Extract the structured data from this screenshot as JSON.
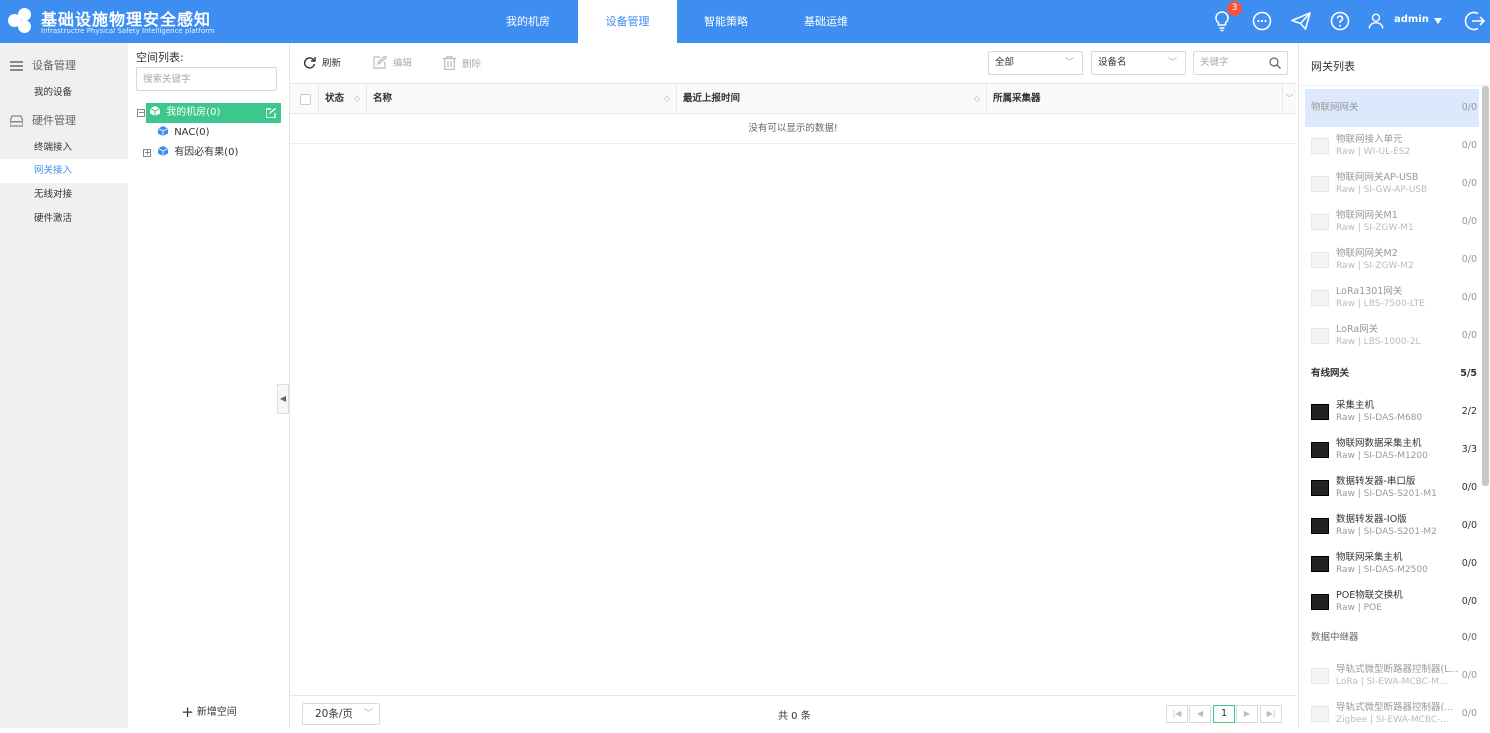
{
  "app": {
    "title": "基础设施物理安全感知",
    "subtitle": "Infrastructre Physical Safety Intelligence platform",
    "accent_color": "#3d8ef0",
    "success_color": "#3ec78c"
  },
  "nav": {
    "items": [
      {
        "label": "我的机房",
        "active": false
      },
      {
        "label": "设备管理",
        "active": true
      },
      {
        "label": "智能策略",
        "active": false
      },
      {
        "label": "基础运维",
        "active": false
      }
    ]
  },
  "topbar": {
    "notification_count": "3",
    "user": "admin",
    "icons": [
      "lightbulb-icon",
      "chat-icon",
      "send-icon",
      "help-icon",
      "user-icon",
      "logout-icon"
    ]
  },
  "sidebar": {
    "groups": [
      {
        "label": "设备管理",
        "icon": "list-icon",
        "items": [
          {
            "label": "我的设备",
            "active": false
          }
        ]
      },
      {
        "label": "硬件管理",
        "icon": "hardware-icon",
        "items": [
          {
            "label": "终端接入",
            "active": false
          },
          {
            "label": "网关接入",
            "active": true
          },
          {
            "label": "无线对接",
            "active": false
          },
          {
            "label": "硬件激活",
            "active": false
          }
        ]
      }
    ]
  },
  "tree": {
    "title": "空间列表:",
    "search_placeholder": "搜索关键字",
    "nodes": [
      {
        "label": "我的机房(0)",
        "toggle": "⊟"
      },
      {
        "label": "NAC(0)"
      },
      {
        "label": "有因必有果(0)",
        "toggle": "⊞"
      }
    ],
    "add_label": "新增空间"
  },
  "toolbar": {
    "refresh": "刷新",
    "edit": "编辑",
    "delete": "删除",
    "filter_scope": "全部",
    "filter_field": "设备名",
    "keyword_placeholder": "关键字"
  },
  "grid": {
    "columns": [
      "状态",
      "名称",
      "最近上报时间",
      "所属采集器"
    ],
    "empty_text": "没有可以显示的数据!"
  },
  "footer": {
    "page_size": "20条/页",
    "total": "共 0 条",
    "current_page": "1"
  },
  "gateways": {
    "title": "网关列表",
    "categories": [
      {
        "label": "物联网网关",
        "count": "0/0",
        "items": [
          {
            "name": "物联网接入单元",
            "model": "Raw | WI-UL-ES2",
            "count": "0/0"
          },
          {
            "name": "物联网网关AP-USB",
            "model": "Raw | SI-GW-AP-USB",
            "count": "0/0"
          },
          {
            "name": "物联网网关M1",
            "model": "Raw | SI-ZGW-M1",
            "count": "0/0"
          },
          {
            "name": "物联网网关M2",
            "model": "Raw | SI-ZGW-M2",
            "count": "0/0"
          },
          {
            "name": "LoRa1301网关",
            "model": "Raw | LBS-7500-LTE",
            "count": "0/0"
          },
          {
            "name": "LoRa网关",
            "model": "Raw | LBS-1000-2L",
            "count": "0/0"
          }
        ]
      },
      {
        "label": "有线网关",
        "count": "5/5",
        "items": [
          {
            "name": "采集主机",
            "model": "Raw | SI-DAS-M680",
            "count": "2/2"
          },
          {
            "name": "物联网数据采集主机",
            "model": "Raw | SI-DAS-M1200",
            "count": "3/3"
          },
          {
            "name": "数据转发器-串口版",
            "model": "Raw | SI-DAS-S201-M1",
            "count": "0/0"
          },
          {
            "name": "数据转发器-IO版",
            "model": "Raw | SI-DAS-S201-M2",
            "count": "0/0"
          },
          {
            "name": "物联网采集主机",
            "model": "Raw | SI-DAS-M2500",
            "count": "0/0"
          },
          {
            "name": "POE物联交换机",
            "model": "Raw | POE",
            "count": "0/0"
          }
        ]
      },
      {
        "label": "数据中继器",
        "count": "0/0",
        "items": [
          {
            "name": "导轨式微型断路器控制器(L...",
            "model": "LoRa | SI-EWA-MCBC-M...",
            "count": "0/0"
          },
          {
            "name": "导轨式微型断路器控制器(...",
            "model": "Zigbee | SI-EWA-MCBC-...",
            "count": "0/0"
          }
        ]
      }
    ]
  }
}
